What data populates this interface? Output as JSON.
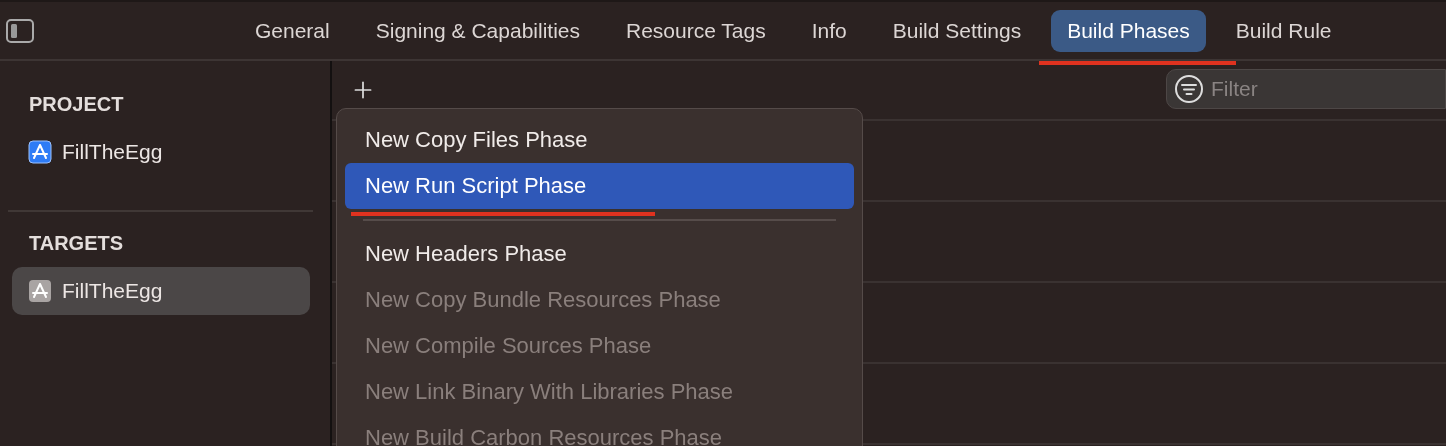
{
  "tabs": [
    {
      "label": "General",
      "selected": false,
      "marked": false
    },
    {
      "label": "Signing & Capabilities",
      "selected": false,
      "marked": false
    },
    {
      "label": "Resource Tags",
      "selected": false,
      "marked": false
    },
    {
      "label": "Info",
      "selected": false,
      "marked": false
    },
    {
      "label": "Build Settings",
      "selected": false,
      "marked": false
    },
    {
      "label": "Build Phases",
      "selected": true,
      "marked": true
    },
    {
      "label": "Build Rule",
      "selected": false,
      "marked": false
    }
  ],
  "sidebar": [
    {
      "title": "PROJECT",
      "items": [
        {
          "label": "FillTheEgg",
          "kind": "project",
          "selected": false
        }
      ]
    },
    {
      "title": "TARGETS",
      "items": [
        {
          "label": "FillTheEgg",
          "kind": "target",
          "selected": true
        }
      ]
    }
  ],
  "filter": {
    "placeholder": "Filter"
  },
  "menu": [
    {
      "kind": "item",
      "label": "New Copy Files Phase",
      "disabled": false,
      "selected": false,
      "marked": false
    },
    {
      "kind": "item",
      "label": "New Run Script Phase",
      "disabled": false,
      "selected": true,
      "marked": true
    },
    {
      "kind": "separator"
    },
    {
      "kind": "item",
      "label": "New Headers Phase",
      "disabled": false,
      "selected": false,
      "marked": false
    },
    {
      "kind": "item",
      "label": "New Copy Bundle Resources Phase",
      "disabled": true,
      "selected": false,
      "marked": false
    },
    {
      "kind": "item",
      "label": "New Compile Sources Phase",
      "disabled": true,
      "selected": false,
      "marked": false
    },
    {
      "kind": "item",
      "label": "New Link Binary With Libraries Phase",
      "disabled": true,
      "selected": false,
      "marked": false
    },
    {
      "kind": "item",
      "label": "New Build Carbon Resources Phase",
      "disabled": true,
      "selected": false,
      "marked": false
    }
  ]
}
